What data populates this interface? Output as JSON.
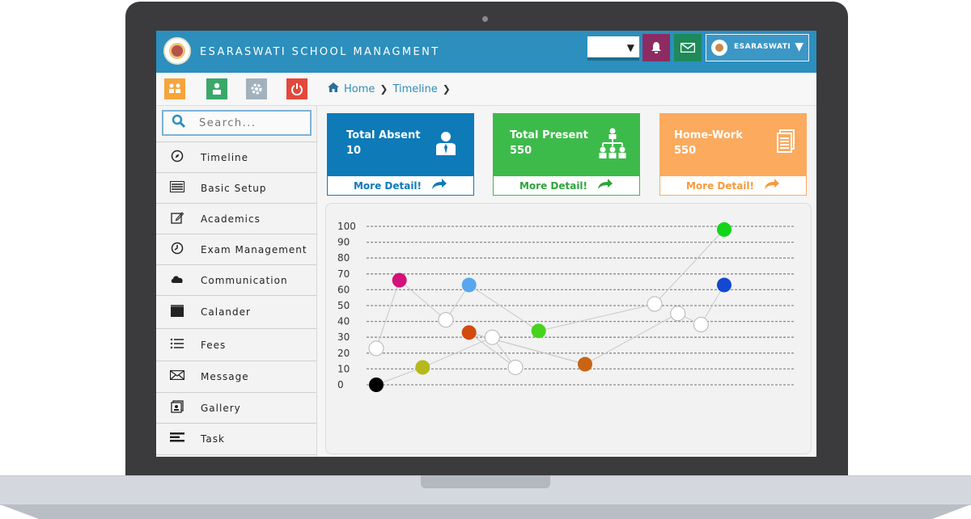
{
  "app": {
    "title": "ESARASWATI SCHOOL MANAGMENT",
    "user_name": "ESARASWATI"
  },
  "header": {
    "select_value": "",
    "icons": {
      "bell": "bell-icon",
      "mail": "mail-icon",
      "user_dropdown": "chevron-down-icon"
    }
  },
  "toolbar": {
    "buttons": [
      {
        "name": "users-icon",
        "color": "#f6a43c"
      },
      {
        "name": "user-icon",
        "color": "#3aa86a"
      },
      {
        "name": "gear-icon",
        "color": "#a3b1bd"
      },
      {
        "name": "power-icon",
        "color": "#e1493c"
      }
    ],
    "breadcrumb": [
      "Home",
      "Timeline"
    ]
  },
  "sidebar": {
    "search_placeholder": "Search...",
    "items": [
      {
        "label": "Timeline",
        "icon": "compass-icon"
      },
      {
        "label": "Basic Setup",
        "icon": "list-icon"
      },
      {
        "label": "Academics",
        "icon": "edit-icon"
      },
      {
        "label": "Exam Management",
        "icon": "clock-icon"
      },
      {
        "label": "Communication",
        "icon": "cloud-icon"
      },
      {
        "label": "Calander",
        "icon": "calendar-icon"
      },
      {
        "label": "Fees",
        "icon": "bullet-list-icon"
      },
      {
        "label": "Message",
        "icon": "envelope-icon"
      },
      {
        "label": "Gallery",
        "icon": "gallery-icon"
      },
      {
        "label": "Task",
        "icon": "task-icon"
      }
    ]
  },
  "cards": [
    {
      "title": "Total Absent",
      "value": "10",
      "link": "More Detail!",
      "color": "#0e7ab8",
      "icon": "user-icon"
    },
    {
      "title": "Total Present",
      "value": "550",
      "link": "More Detail!",
      "color": "#3dbb4a",
      "icon": "group-icon"
    },
    {
      "title": "Home-Work",
      "value": "550",
      "link": "More Detail!",
      "color": "#fbaa5e",
      "icon": "document-icon"
    }
  ],
  "chart_data": {
    "type": "scatter",
    "y_ticks": [
      0,
      10,
      20,
      30,
      40,
      50,
      60,
      70,
      80,
      90,
      100
    ],
    "ylim": [
      0,
      100
    ],
    "grid": true,
    "series": [
      {
        "color": "#ffffff",
        "points": [
          [
            0,
            23
          ],
          [
            3,
            41
          ],
          [
            5,
            30
          ],
          [
            6,
            11
          ],
          [
            12,
            51
          ],
          [
            13,
            45
          ],
          [
            14,
            38
          ]
        ],
        "connect": false
      },
      {
        "color": "#000000",
        "points": [
          [
            0,
            0
          ]
        ]
      },
      {
        "color": "#d4107a",
        "points": [
          [
            1,
            66
          ]
        ]
      },
      {
        "color": "#b6b81c",
        "points": [
          [
            2,
            11
          ]
        ]
      },
      {
        "color": "#5aa6ee",
        "points": [
          [
            4,
            63
          ]
        ]
      },
      {
        "color": "#d24a0e",
        "points": [
          [
            4,
            33
          ]
        ]
      },
      {
        "color": "#46d31c",
        "points": [
          [
            7,
            34
          ]
        ]
      },
      {
        "color": "#c86414",
        "points": [
          [
            9,
            13
          ]
        ]
      },
      {
        "color": "#12d41a",
        "points": [
          [
            15,
            98
          ]
        ]
      },
      {
        "color": "#1348d0",
        "points": [
          [
            15,
            63
          ]
        ]
      }
    ],
    "lines": [
      {
        "stroke": "#c8c8c8",
        "points": [
          [
            0,
            23
          ],
          [
            1,
            66
          ],
          [
            3,
            41
          ],
          [
            4,
            63
          ],
          [
            7,
            34
          ],
          [
            12,
            51
          ],
          [
            15,
            98
          ]
        ]
      },
      {
        "stroke": "#c8c8c8",
        "points": [
          [
            0,
            0
          ],
          [
            2,
            11
          ],
          [
            5,
            30
          ],
          [
            6,
            11
          ],
          [
            4,
            33
          ],
          [
            9,
            13
          ],
          [
            13,
            45
          ],
          [
            14,
            38
          ],
          [
            15,
            63
          ]
        ]
      },
      {
        "stroke": "#c8c8c8",
        "points": [
          [
            4,
            33
          ],
          [
            9,
            13
          ]
        ]
      }
    ]
  }
}
